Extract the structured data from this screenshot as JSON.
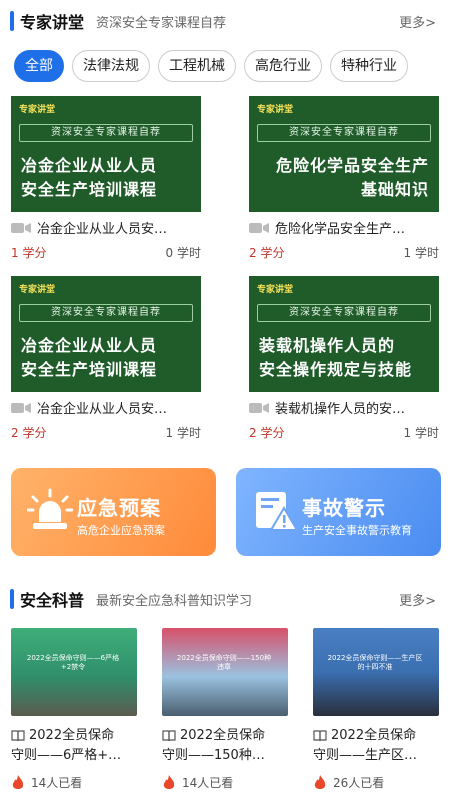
{
  "expert": {
    "title": "专家讲堂",
    "subtitle": "资深安全专家课程自荐",
    "more": "更多>"
  },
  "tabs": [
    "全部",
    "法律法规",
    "工程机械",
    "高危行业",
    "特种行业"
  ],
  "courses": [
    {
      "brand": "专家讲堂",
      "tagline": "资深安全专家课程自荐",
      "thumb_line1": "冶金企业从业人员",
      "thumb_line2": "安全生产培训课程",
      "align": "left",
      "title": "冶金企业从业人员安…",
      "credit": "1 学分",
      "hours": "0 学时"
    },
    {
      "brand": "专家讲堂",
      "tagline": "资深安全专家课程自荐",
      "thumb_line1": "危险化学品安全生产",
      "thumb_line2": "基础知识",
      "align": "right",
      "title": "危险化学品安全生产…",
      "credit": "2 学分",
      "hours": "1 学时"
    },
    {
      "brand": "专家讲堂",
      "tagline": "资深安全专家课程自荐",
      "thumb_line1": "冶金企业从业人员",
      "thumb_line2": "安全生产培训课程",
      "align": "left",
      "title": "冶金企业从业人员安…",
      "credit": "2 学分",
      "hours": "1 学时"
    },
    {
      "brand": "专家讲堂",
      "tagline": "资深安全专家课程自荐",
      "thumb_line1": "装载机操作人员的",
      "thumb_line2": "安全操作规定与技能",
      "align": "left",
      "title": "装载机操作人员的安…",
      "credit": "2 学分",
      "hours": "1 学时"
    }
  ],
  "promos": [
    {
      "title": "应急预案",
      "subtitle": "高危企业应急预案",
      "icon": "alarm-light-icon"
    },
    {
      "title": "事故警示",
      "subtitle": "生产安全事故警示教育",
      "icon": "warning-document-icon"
    }
  ],
  "science": {
    "title": "安全科普",
    "subtitle": "最新安全应急科普知识学习",
    "more": "更多>",
    "items": [
      {
        "banner": "2022全员保命守则——6严格+2禁令",
        "line1": "2022全员保命",
        "line2": "守则——6严格+…",
        "views": "14人已看",
        "img_color": "#2f8f6b"
      },
      {
        "banner": "2022全员保命守则——150种违章",
        "line1": "2022全员保命",
        "line2": "守则——150种…",
        "views": "14人已看",
        "img_color": "#c34f6a"
      },
      {
        "banner": "2022全员保命守则——生产区的十四不准",
        "line1": "2022全员保命",
        "line2": "守则——生产区…",
        "views": "26人已看",
        "img_color": "#3a6fb0"
      }
    ]
  },
  "colors": {
    "accent": "#1e6fe8",
    "credit_red": "#c2362a",
    "thumb_green": "#1f5c2a"
  }
}
